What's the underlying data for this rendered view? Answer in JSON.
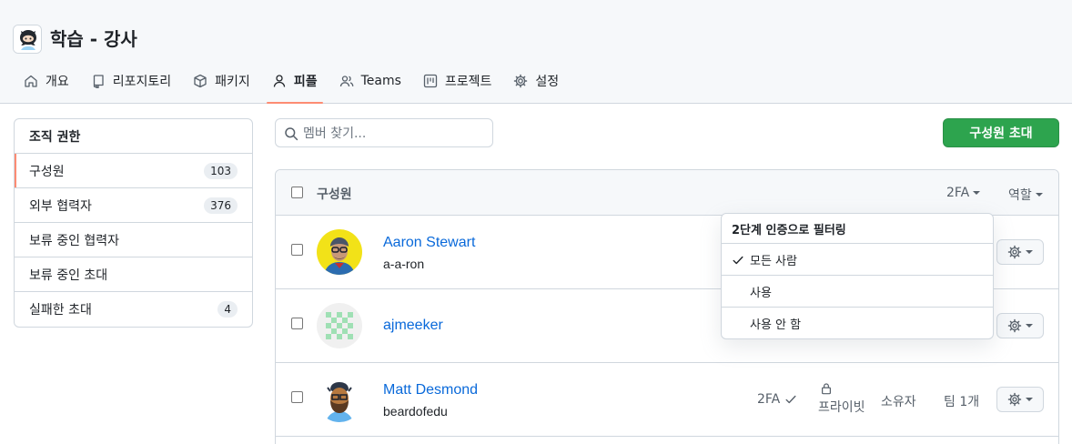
{
  "org": {
    "title": "학습 - 강사"
  },
  "tabs": [
    {
      "label": "개요",
      "icon": "home-icon"
    },
    {
      "label": "리포지토리",
      "icon": "repo-icon"
    },
    {
      "label": "패키지",
      "icon": "package-icon"
    },
    {
      "label": "피플",
      "icon": "person-icon",
      "active": true
    },
    {
      "label": "Teams",
      "icon": "people-icon"
    },
    {
      "label": "프로젝트",
      "icon": "project-icon"
    },
    {
      "label": "설정",
      "icon": "gear-icon"
    }
  ],
  "sidebar": {
    "heading": "조직 권한",
    "items": [
      {
        "label": "구성원",
        "count": "103",
        "selected": true
      },
      {
        "label": "외부 협력자",
        "count": "376"
      },
      {
        "label": "보류 중인 협력자",
        "count": ""
      },
      {
        "label": "보류 중인 초대",
        "count": ""
      },
      {
        "label": "실패한 초대",
        "count": "4"
      }
    ]
  },
  "search": {
    "placeholder": "멤버 찾기..."
  },
  "invite_button": "구성원 초대",
  "table": {
    "header": "구성원",
    "filter_2fa": "2FA",
    "filter_role": "역할",
    "members": [
      {
        "name": "Aaron Stewart",
        "login": "a-a-ron"
      },
      {
        "name": "ajmeeker",
        "login": ""
      },
      {
        "name": "Matt Desmond",
        "login": "beardofedu",
        "twofa": "2FA",
        "visibility": "프라이빗",
        "role": "소유자",
        "teams": "팀 1개"
      }
    ]
  },
  "dropdown": {
    "title": "2단계 인증으로 필터링",
    "options": [
      {
        "label": "모든 사람",
        "checked": true
      },
      {
        "label": "사용",
        "checked": false
      },
      {
        "label": "사용 안 함",
        "checked": false
      }
    ]
  },
  "colors": {
    "accent_underline": "#fd8c73",
    "primary_button": "#2da44e",
    "link": "#0969da"
  }
}
